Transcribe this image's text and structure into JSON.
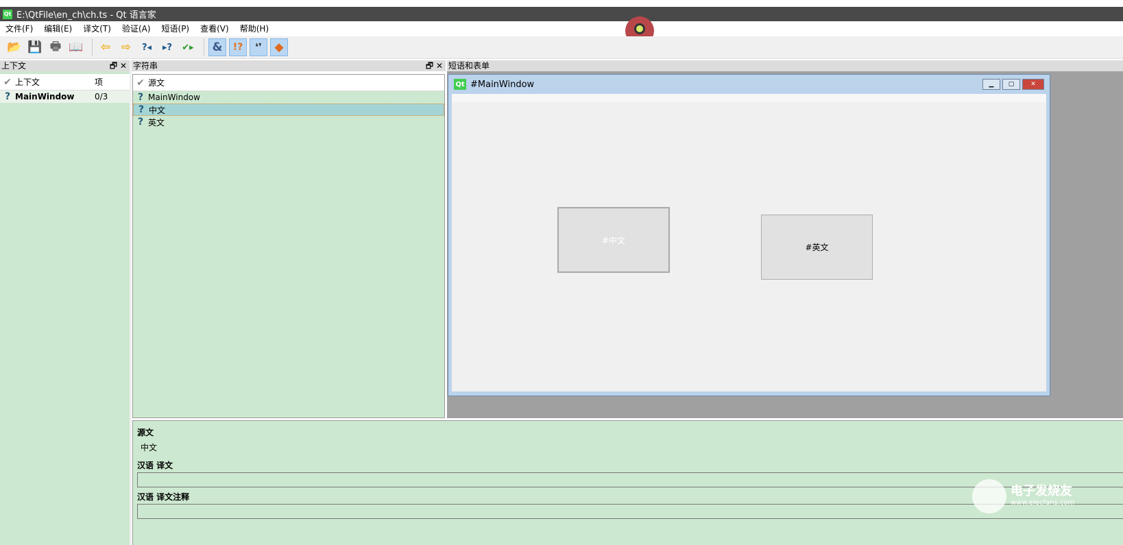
{
  "window": {
    "title": "E:\\QtFile\\en_ch\\ch.ts - Qt 语言家",
    "logo": "Qt"
  },
  "menu": [
    "文件(F)",
    "编辑(E)",
    "译文(T)",
    "验证(A)",
    "短语(P)",
    "查看(V)",
    "帮助(H)"
  ],
  "toolbar": [
    {
      "icon": "open-folder-icon",
      "glyph": "📂"
    },
    {
      "icon": "save-icon",
      "glyph": "💾"
    },
    {
      "icon": "print-icon",
      "glyph": "🖶"
    },
    {
      "icon": "phrasebook-icon",
      "glyph": "📖"
    },
    {
      "icon": "prev-icon",
      "glyph": "⇦"
    },
    {
      "icon": "next-icon",
      "glyph": "⇨"
    },
    {
      "icon": "prev-unfinished-icon",
      "glyph": "?◂"
    },
    {
      "icon": "next-unfinished-icon",
      "glyph": "▸?"
    },
    {
      "icon": "done-next-icon",
      "glyph": "✔▸"
    },
    {
      "icon": "accelerators-icon",
      "glyph": "&"
    },
    {
      "icon": "punctuation-icon",
      "glyph": "!?"
    },
    {
      "icon": "phrase-matches-icon",
      "glyph": "❛❜"
    },
    {
      "icon": "placemarker-icon",
      "glyph": "◆"
    }
  ],
  "context_panel": {
    "title": "上下文",
    "col_context": "上下文",
    "col_items": "项",
    "rows": [
      {
        "name": "MainWindow",
        "items": "0/3"
      }
    ]
  },
  "strings_panel": {
    "title": "字符串",
    "col_source": "源文",
    "rows": [
      "MainWindow",
      "中文",
      "英文"
    ],
    "selected": 1
  },
  "forms_panel": {
    "title": "短语和表单",
    "form_title": "#MainWindow",
    "form_logo": "Qt",
    "button1": "#中文",
    "button2": "#英文"
  },
  "editor": {
    "source_label": "源文",
    "source_text": "中文",
    "translation_label": "汉语  译文",
    "comment_label": "汉语  译文注释"
  },
  "watermark": {
    "name": "电子发烧友",
    "url": "www.elecfans.com"
  }
}
